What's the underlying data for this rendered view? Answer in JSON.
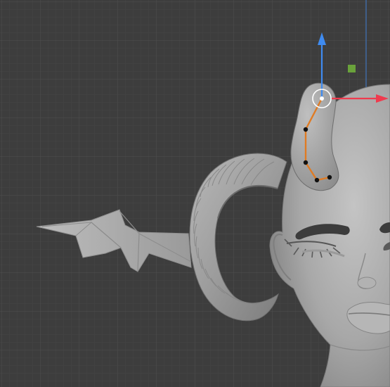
{
  "viewport": {
    "background_color": "#3d3d3d",
    "grid_minor_color": "#444444",
    "grid_major_color": "#4b4b4b",
    "mesh_color": "#a7a7a7",
    "mesh_shadow_color": "#6d6d6d",
    "path_color": "#e07b23",
    "gizmo_x_color": "#ef3b4e",
    "gizmo_z_color": "#3f8bf0",
    "gizmo_handle_color": "#6aa23b"
  },
  "scene_objects": [
    {
      "name": "head",
      "icon": "head-mesh-icon"
    },
    {
      "name": "horn-ribbed",
      "icon": "horn-mesh-icon"
    },
    {
      "name": "horn-selected",
      "icon": "horn-mesh-icon"
    },
    {
      "name": "wing",
      "icon": "wing-mesh-icon"
    },
    {
      "name": "curve-path",
      "icon": "curve-icon"
    }
  ],
  "transform_gizmo": {
    "icons": [
      "arrow-up-icon",
      "arrow-right-icon",
      "square-handle-icon",
      "pivot-circle-icon"
    ]
  }
}
